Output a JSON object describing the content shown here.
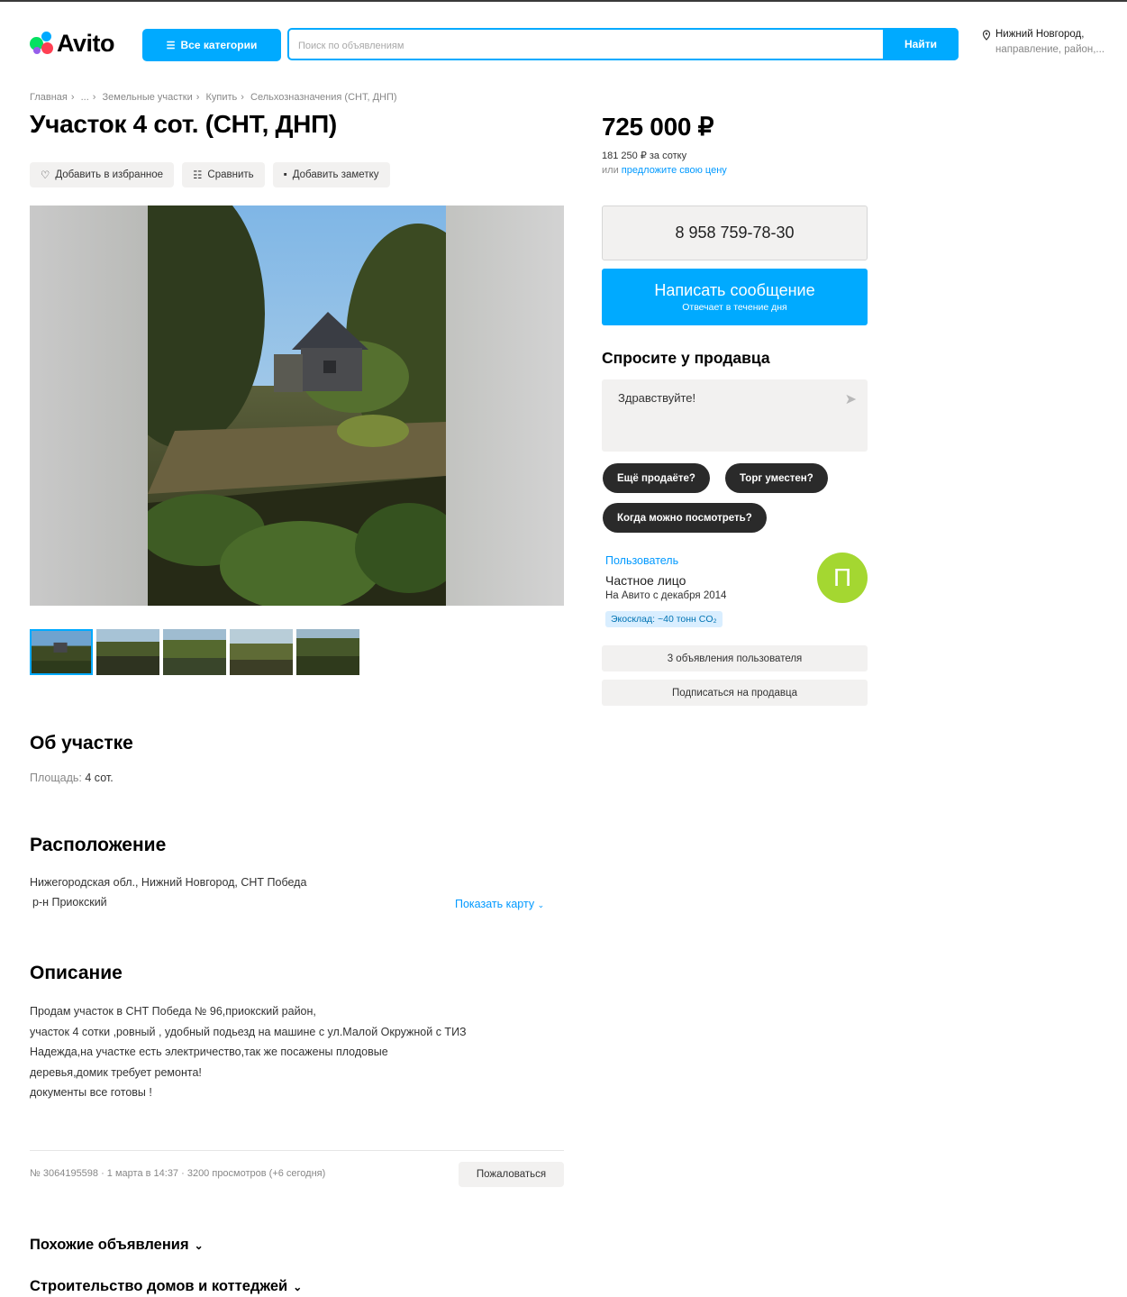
{
  "header": {
    "logo": "Avito",
    "all_categories": "Все категории",
    "search_placeholder": "Поиск по объявлениям",
    "search_button": "Найти",
    "city": "Нижний Новгород,",
    "city_sub": "направление, район,..."
  },
  "breadcrumbs": [
    "Главная",
    "...",
    "Земельные участки",
    "Купить",
    "Сельхозназначения (СНТ, ДНП)"
  ],
  "listing": {
    "title": "Участок 4 сот. (СНТ, ДНП)",
    "actions": {
      "favorite": "Добавить в избранное",
      "compare": "Сравнить",
      "note": "Добавить заметку"
    }
  },
  "about": {
    "heading": "Об участке",
    "area_label": "Площадь:",
    "area_value": "4 сот."
  },
  "location": {
    "heading": "Расположение",
    "address": "Нижегородская обл., Нижний Новгород, СНТ Победа",
    "district": "р-н Приокский",
    "show_map": "Показать карту"
  },
  "description": {
    "heading": "Описание",
    "lines": [
      "Продам участок в СНТ Победа № 96,приокский район,",
      "участок 4 сотки ,ровный , удобный подьезд на машине с ул.Малой Окружной с ТИЗ",
      "Надежда,на участке есть электричество,так же посажены плодовые",
      "деревья,домик требует ремонта!",
      "документы все готовы !"
    ]
  },
  "meta": {
    "info": "№ 3064195598 · 1 марта в 14:37 · 3200 просмотров (+6 сегодня)",
    "complain": "Пожаловаться"
  },
  "collapsibles": {
    "similar": "Похожие объявления",
    "construction": "Строительство домов и коттеджей"
  },
  "sidebar": {
    "price": "725 000 ₽",
    "price_per": "181 250 ₽ за сотку",
    "offer_prefix": "или",
    "offer_link": "предложите свою цену",
    "phone": "8 958 759-78-30",
    "message_btn": "Написать сообщение",
    "message_sub": "Отвечает в течение дня",
    "ask_title": "Спросите у продавца",
    "ask_default": "Здравствуйте!",
    "chips": [
      "Ещё продаёте?",
      "Торг уместен?",
      "Когда можно посмотреть?"
    ],
    "seller": {
      "name": "Пользователь",
      "type": "Частное лицо",
      "since": "На Авито с декабря 2014",
      "eco": "Экосклад: ~40 тонн CO₂",
      "avatar_letter": "П",
      "listings_btn": "3 объявления пользователя",
      "subscribe_btn": "Подписаться на продавца"
    }
  },
  "colors": {
    "accent": "#00aaff",
    "chip_bg": "#2a2a2a",
    "avatar_bg": "#a4d731"
  }
}
